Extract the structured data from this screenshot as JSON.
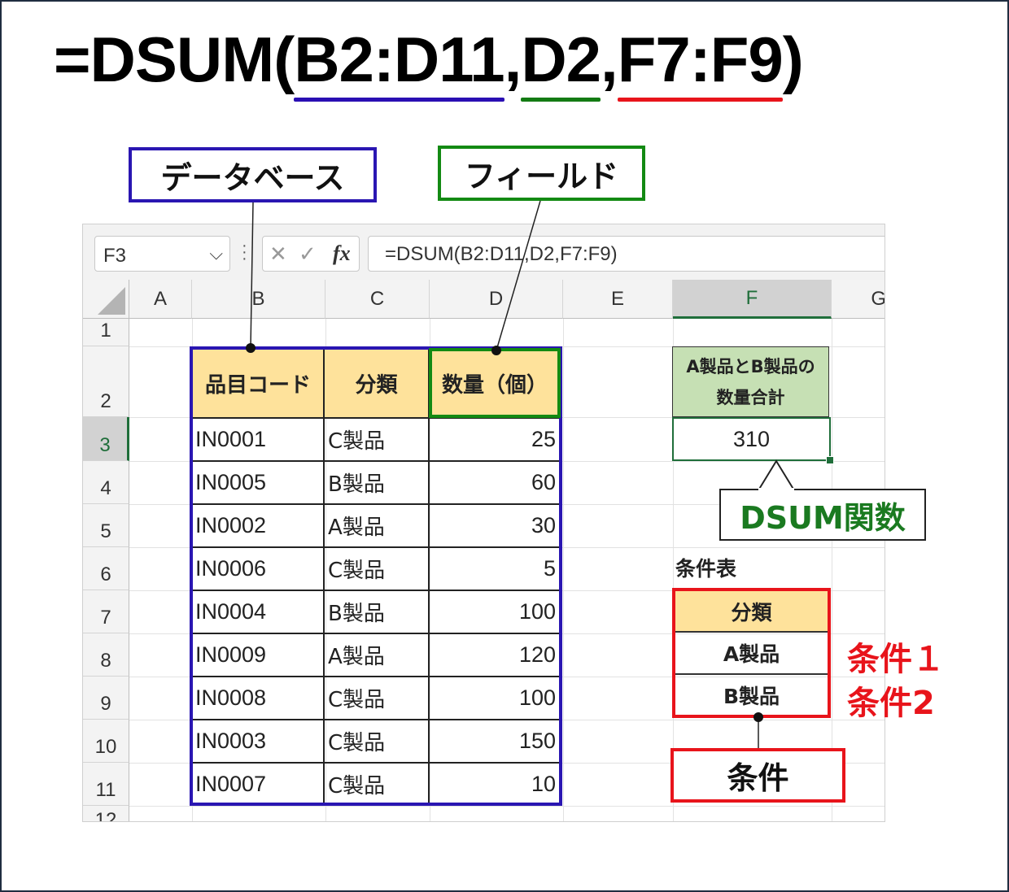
{
  "formula": {
    "prefix": "=DSUM(",
    "arg_database": "B2:D11",
    "comma1": ",",
    "arg_field": "D2",
    "comma2": ",",
    "arg_criteria": "F7:F9",
    "suffix": ")"
  },
  "callouts": {
    "database": "データベース",
    "field": "フィールド",
    "function": "DSUM関数",
    "criteria": "条件"
  },
  "formula_bar": {
    "name_box": "F3",
    "formula": "=DSUM(B2:D11,D2,F7:F9)"
  },
  "columns": [
    "A",
    "B",
    "C",
    "D",
    "E",
    "F",
    "G"
  ],
  "rows": [
    "1",
    "2",
    "3",
    "4",
    "5",
    "6",
    "7",
    "8",
    "9",
    "10",
    "11",
    "12"
  ],
  "table": {
    "headers": [
      "品目コード",
      "分類",
      "数量（個）"
    ],
    "rows": [
      [
        "IN0001",
        "C製品",
        "25"
      ],
      [
        "IN0005",
        "B製品",
        "60"
      ],
      [
        "IN0002",
        "A製品",
        "30"
      ],
      [
        "IN0006",
        "C製品",
        "5"
      ],
      [
        "IN0004",
        "B製品",
        "100"
      ],
      [
        "IN0009",
        "A製品",
        "120"
      ],
      [
        "IN0008",
        "C製品",
        "100"
      ],
      [
        "IN0003",
        "C製品",
        "150"
      ],
      [
        "IN0007",
        "C製品",
        "10"
      ]
    ]
  },
  "result": {
    "header_line1": "A製品とB製品の",
    "header_line2": "数量合計",
    "value": "310"
  },
  "criteria_table": {
    "title": "条件表",
    "header": "分類",
    "values": [
      "A製品",
      "B製品"
    ],
    "labels": [
      "条件１",
      "条件2"
    ]
  },
  "colors": {
    "database": "#2a16b2",
    "field": "#138a13",
    "criteria": "#e8141b",
    "header_fill": "#fee29b",
    "result_fill": "#c6e0b4",
    "function_text": "#1a7a20"
  }
}
